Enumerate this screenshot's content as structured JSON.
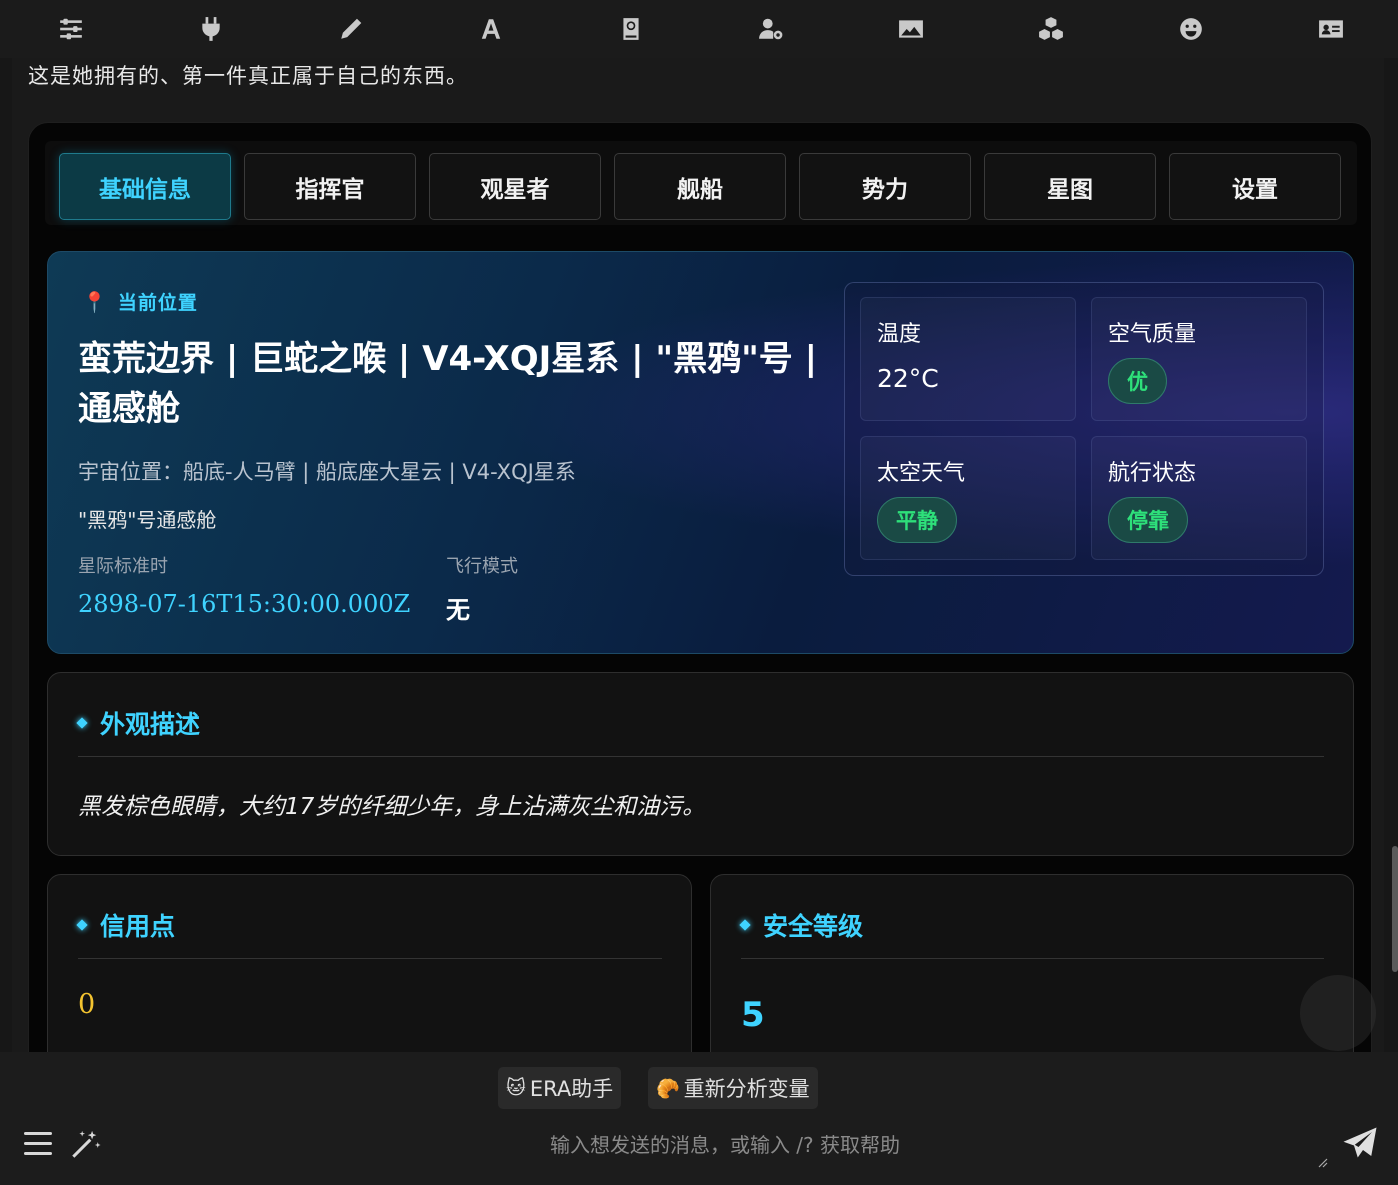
{
  "toolbar": {
    "icons": [
      "sliders-icon",
      "plug-icon",
      "pencil-icon",
      "font-icon",
      "book-icon",
      "user-gear-icon",
      "image-icon",
      "cubes-icon",
      "smile-icon",
      "id-card-icon"
    ]
  },
  "message": {
    "text": "这是她拥有的、第一件真正属于自己的东西。"
  },
  "tabs": [
    {
      "label": "基础信息",
      "active": true
    },
    {
      "label": "指挥官",
      "active": false
    },
    {
      "label": "观星者",
      "active": false
    },
    {
      "label": "舰船",
      "active": false
    },
    {
      "label": "势力",
      "active": false
    },
    {
      "label": "星图",
      "active": false
    },
    {
      "label": "设置",
      "active": false
    }
  ],
  "location": {
    "label": "当前位置",
    "title": "蛮荒边界 | 巨蛇之喉 | V4-XQJ星系 | \"黑鸦\"号 | 通感舱",
    "cosmic": "宇宙位置：船底-人马臂 | 船底座大星云 | V4-XQJ星系",
    "cabin": "\"黑鸦\"号通感舱",
    "time_label": "星际标准时",
    "time_value": "2898-07-16T15:30:00.000Z",
    "flight_label": "飞行模式",
    "flight_value": "无"
  },
  "environment": {
    "temp_label": "温度",
    "temp_value": "22°C",
    "air_label": "空气质量",
    "air_value": "优",
    "weather_label": "太空天气",
    "weather_value": "平静",
    "nav_label": "航行状态",
    "nav_value": "停靠"
  },
  "appearance": {
    "title": "外观描述",
    "text": "黑发棕色眼睛，大约17岁的纤细少年，身上沾满灰尘和油污。"
  },
  "credits": {
    "title": "信用点",
    "value": "0"
  },
  "safety": {
    "title": "安全等级",
    "value": "5"
  },
  "composer": {
    "quick_buttons": [
      {
        "emoji": "🐱",
        "label": "ERA助手"
      },
      {
        "emoji": "🥐",
        "label": "重新分析变量"
      }
    ],
    "placeholder": "输入想发送的消息，或输入 /? 获取帮助"
  },
  "colors": {
    "accent": "#3fd3ff",
    "gold": "#f4c430",
    "green": "#2ee07a"
  }
}
